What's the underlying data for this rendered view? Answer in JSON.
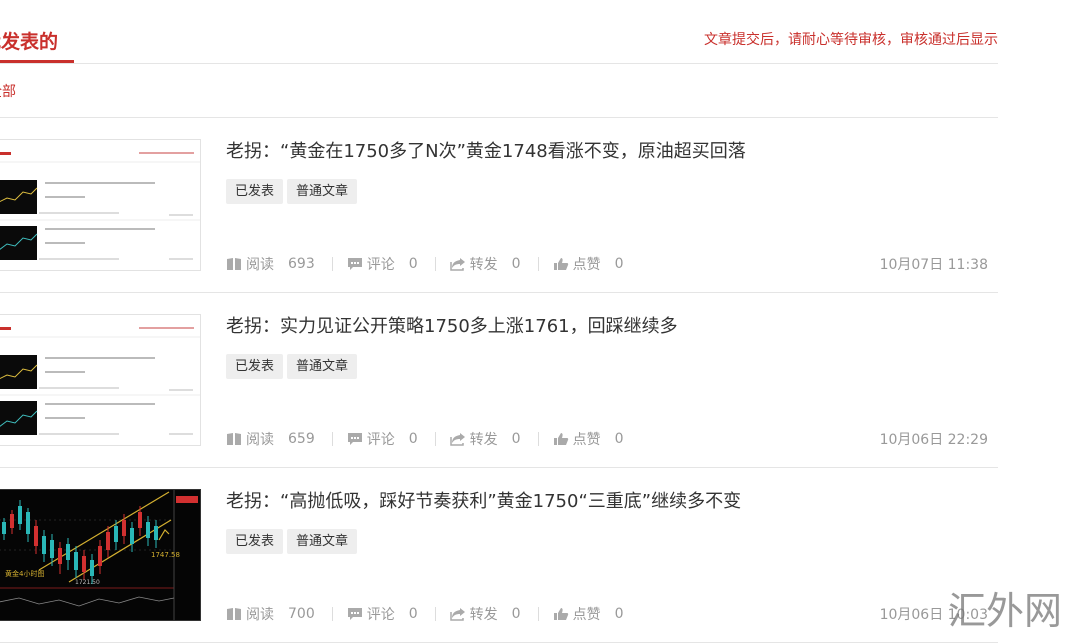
{
  "header": {
    "title": "我发表的",
    "notice": "文章提交后，请耐心等待审核，审核通过后显示"
  },
  "filter": {
    "all": "全部"
  },
  "stat_labels": {
    "read": "阅读",
    "comment": "评论",
    "forward": "转发",
    "like": "点赞"
  },
  "articles": [
    {
      "title": "老拐：“黄金在1750多了N次”黄金1748看涨不变，原油超买回落",
      "tags": [
        "已发表",
        "普通文章"
      ],
      "reads": "693",
      "comments": "0",
      "forwards": "0",
      "likes": "0",
      "date": "10月07日 11:38",
      "thumb": "page-screenshot"
    },
    {
      "title": "老拐：实力见证公开策略1750多上涨1761，回踩继续多",
      "tags": [
        "已发表",
        "普通文章"
      ],
      "reads": "659",
      "comments": "0",
      "forwards": "0",
      "likes": "0",
      "date": "10月06日 22:29",
      "thumb": "page-screenshot"
    },
    {
      "title": "老拐：“高抛低吸，踩好节奏获利”黄金1750“三重底”继续多不变",
      "tags": [
        "已发表",
        "普通文章"
      ],
      "reads": "700",
      "comments": "0",
      "forwards": "0",
      "likes": "0",
      "date": "10月06日 10:03",
      "thumb": "candlestick-chart",
      "thumb_text": {
        "label": "黄金4小时图",
        "price": "1747.58",
        "low": "1721.50"
      }
    }
  ],
  "watermark": "汇外网",
  "colors": {
    "accent": "#c9302c",
    "muted": "#999999",
    "tag_bg": "#eeeeee",
    "divider": "#e5e5e5"
  }
}
